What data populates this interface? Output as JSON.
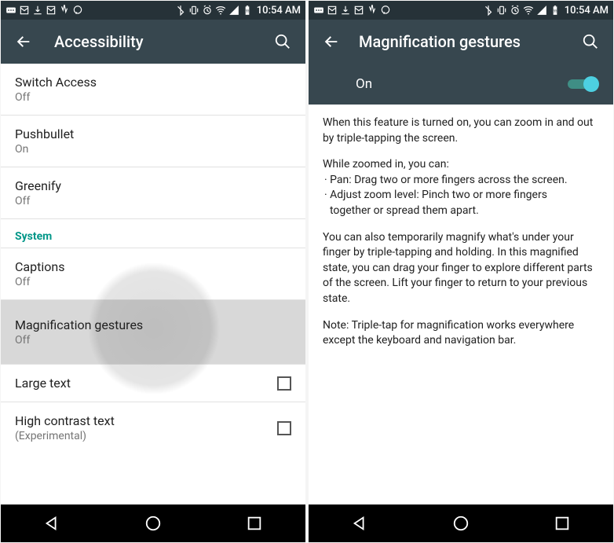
{
  "status_bar": {
    "time": "10:54 AM"
  },
  "left": {
    "title": "Accessibility",
    "section_system": "System",
    "items": {
      "switch_access": {
        "title": "Switch Access",
        "sub": "Off"
      },
      "pushbullet": {
        "title": "Pushbullet",
        "sub": "On"
      },
      "greenify": {
        "title": "Greenify",
        "sub": "Off"
      },
      "captions": {
        "title": "Captions",
        "sub": "Off"
      },
      "magnification": {
        "title": "Magnification gestures",
        "sub": "Off"
      },
      "large_text": {
        "title": "Large text"
      },
      "high_contrast": {
        "title": "High contrast text",
        "sub": "(Experimental)"
      }
    }
  },
  "right": {
    "title": "Magnification gestures",
    "toggle_state": "On",
    "p1": "When this feature is turned on, you can zoom in and out by triple-tapping the screen.",
    "p2a": "While zoomed in, you can:",
    "p2b": "· Pan: Drag two or more fingers across the screen.",
    "p2c": "· Adjust zoom level: Pinch two or more fingers",
    "p2d": "  together or spread them apart.",
    "p3": "You can also temporarily magnify what's under your finger by triple-tapping and holding. In this magnified state, you can drag your finger to explore different parts of the screen. Lift your finger to return to your previous state.",
    "p4": "Note: Triple-tap for magnification works everywhere except the keyboard and navigation bar."
  }
}
